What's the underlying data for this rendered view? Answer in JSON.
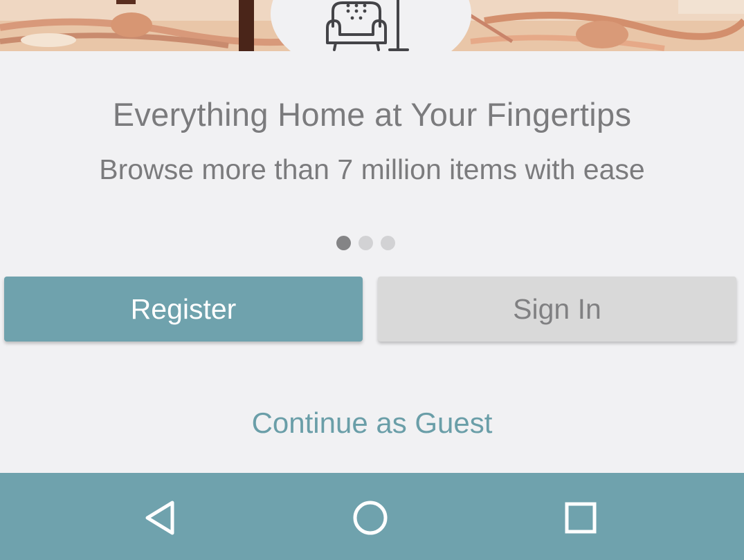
{
  "hero": {
    "image": "room-photo-banner",
    "icon": "armchair-lamp-icon"
  },
  "onboarding": {
    "title": "Everything Home at Your Fingertips",
    "subtitle": "Browse more than 7 million items with ease",
    "page_indicator": {
      "count": 3,
      "active": 1
    }
  },
  "actions": {
    "register_label": "Register",
    "signin_label": "Sign In",
    "guest_label": "Continue as Guest"
  },
  "navbar": {
    "back_icon": "back-triangle-icon",
    "home_icon": "home-circle-icon",
    "recents_icon": "recents-square-icon"
  },
  "colors": {
    "accent": "#6fa2ad",
    "background": "#f1f1f3",
    "text": "#7b7b7d",
    "secondary_button": "#d9d9d9"
  }
}
